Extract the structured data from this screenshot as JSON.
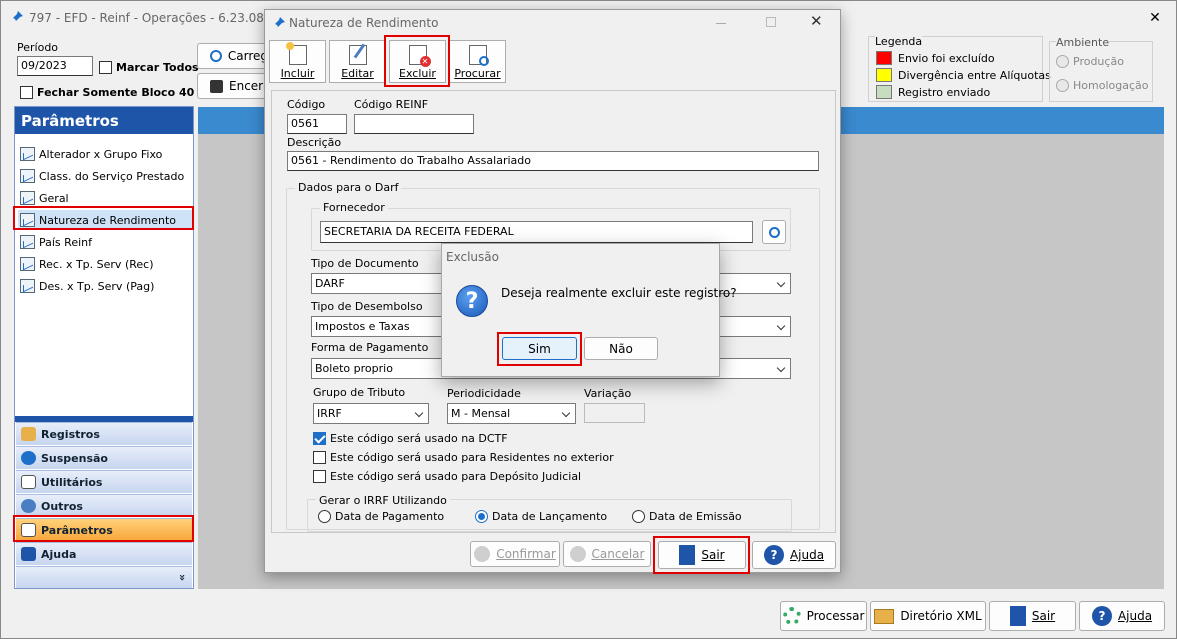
{
  "app": {
    "title": "797 - EFD - Reinf - Operações - 6.23.08.32",
    "close_label": "✕"
  },
  "header": {
    "periodo_label": "Período",
    "periodo_value": "09/2023",
    "marcar_todos_label": "Marcar Todos",
    "fechar_bloco_label": "Fechar Somente Bloco 40",
    "carregar_label": "Carreg",
    "encerrar_label": "Encerr"
  },
  "legend": {
    "title": "Legenda",
    "items": [
      {
        "label": "Envio foi excluído",
        "color": "#ff0000"
      },
      {
        "label": "Divergência entre Alíquotas",
        "color": "#ffff00"
      },
      {
        "label": "Registro enviado",
        "color": "#c8dcc0"
      }
    ]
  },
  "ambiente": {
    "title": "Ambiente",
    "options": [
      "Produção",
      "Homologação"
    ]
  },
  "sidebar": {
    "title": "Parâmetros",
    "items": [
      {
        "label": "Alterador x Grupo Fixo"
      },
      {
        "label": "Class. do Serviço Prestado"
      },
      {
        "label": "Geral"
      },
      {
        "label": "Natureza de Rendimento"
      },
      {
        "label": "País Reinf"
      },
      {
        "label": "Rec. x Tp. Serv (Rec)"
      },
      {
        "label": "Des. x Tp. Serv (Pag)"
      }
    ],
    "groups": [
      {
        "label": "Registros"
      },
      {
        "label": "Suspensão"
      },
      {
        "label": "Utilitários"
      },
      {
        "label": "Outros"
      },
      {
        "label": "Parâmetros"
      },
      {
        "label": "Ajuda"
      }
    ],
    "more": "»"
  },
  "footer": {
    "processar": "Processar",
    "diretorio": "Diretório XML",
    "sair": "Sair",
    "ajuda": "Ajuda"
  },
  "dialog": {
    "title": "Natureza de Rendimento",
    "toolbar": {
      "incluir": "Incluir",
      "editar": "Editar",
      "excluir": "Excluir",
      "procurar": "Procurar"
    },
    "codigo_label": "Código",
    "codigo_value": "0561",
    "codigo_reinf_label": "Código REINF",
    "codigo_reinf_value": "",
    "descricao_label": "Descrição",
    "descricao_value": "0561 - Rendimento do Trabalho Assalariado",
    "darf_group": "Dados para o Darf",
    "fornecedor_label": "Fornecedor",
    "fornecedor_value": "SECRETARIA DA RECEITA FEDERAL",
    "tipo_doc_label": "Tipo de Documento",
    "tipo_doc_value": "DARF",
    "tipo_desemb_label": "Tipo de Desembolso",
    "tipo_desemb_value": "Impostos e Taxas",
    "forma_pag_label": "Forma de Pagamento",
    "forma_pag_value": "Boleto proprio",
    "grupo_tributo_label": "Grupo de Tributo",
    "grupo_tributo_value": "IRRF",
    "periodicidade_label": "Periodicidade",
    "periodicidade_value": "M - Mensal",
    "variacao_label": "Variação",
    "variacao_value": "",
    "check_dctf": "Este código será usado na DCTF",
    "check_residentes": "Este código será usado para Residentes no exterior",
    "check_deposito": "Este código será usado para Depósito Judicial",
    "irrf_group": "Gerar o IRRF Utilizando",
    "radio_pagamento": "Data de Pagamento",
    "radio_lancamento": "Data de Lançamento",
    "radio_emissao": "Data de Emissão",
    "confirmar": "Confirmar",
    "cancelar": "Cancelar",
    "sair": "Sair",
    "ajuda": "Ajuda"
  },
  "confirm": {
    "title": "Exclusão",
    "message": "Deseja realmente excluir este registro?",
    "icon": "?",
    "yes": "Sim",
    "no": "Não"
  }
}
